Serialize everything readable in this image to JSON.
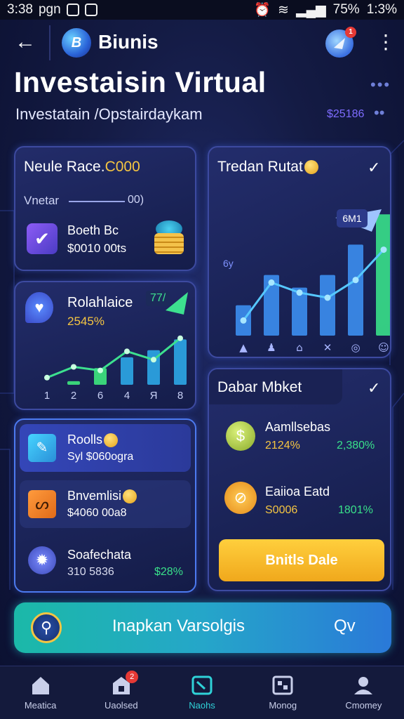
{
  "status_bar": {
    "time_left": "3:38",
    "carrier": "pgn",
    "battery": "75%",
    "time_right": "1:3%"
  },
  "header": {
    "app_name": "Biunis",
    "logo_text": "B",
    "notif_count": "1"
  },
  "title": "Investaisin Virtual",
  "subtitle": "Investatain /Opstairdaykam",
  "subtitle_amount": "$25186",
  "card_rate": {
    "title": "Neule Race.",
    "title_value": "C000",
    "row_label": "Vnetar",
    "row_value": "00)",
    "item_name": "Boeth Bc",
    "item_value": "$0010 00ts"
  },
  "card_trend": {
    "title": "Tredan Rutat",
    "badge": "6M1",
    "ylabel": "6y",
    "values": [
      1.2,
      2.4,
      1.9,
      2.4,
      3.6,
      4.8
    ],
    "line": [
      0.6,
      2.1,
      1.7,
      1.5,
      2.2,
      3.4
    ]
  },
  "card_perf": {
    "title": "Rolahlaice",
    "value": "2545%",
    "tag": "77/",
    "xlabels": [
      "1",
      "2",
      "6",
      "4",
      "Я",
      "8"
    ],
    "bars": [
      0,
      0.3,
      1.4,
      2.3,
      2.9,
      3.8
    ],
    "line": [
      0.6,
      1.5,
      1.2,
      2.8,
      2.1,
      3.9
    ]
  },
  "card_list": {
    "items": [
      {
        "name": "Roolls",
        "value": "Syl $060ogra",
        "icon": "ruler-icon"
      },
      {
        "name": "Bnvemlisi",
        "value": "$4060 00a8",
        "icon": "swirl-icon"
      },
      {
        "name": "Soafechata",
        "value": "310 5836",
        "change": "$28%",
        "icon": "gear-icon"
      }
    ]
  },
  "card_market": {
    "title": "Dabar Mbket",
    "items": [
      {
        "name": "Aamllsebas",
        "change_a": "2124%",
        "change_b": "2,380%"
      },
      {
        "name": "Eaiioa Eatd",
        "value": "S0006",
        "change_b": "1801%"
      }
    ],
    "button": "Bnitls Dale"
  },
  "cta": {
    "label": "Inapkan Varsolgis",
    "right": "Qv"
  },
  "nav": [
    {
      "label": "Meatica",
      "icon": "home-icon"
    },
    {
      "label": "Uaolsed",
      "icon": "store-icon",
      "badge": "2"
    },
    {
      "label": "Naohs",
      "icon": "chart-icon"
    },
    {
      "label": "Monog",
      "icon": "calendar-icon"
    },
    {
      "label": "Cmomey",
      "icon": "user-icon"
    }
  ],
  "colors": {
    "accent": "#2fd2d8",
    "green": "#39e08a",
    "gold": "#f5c542",
    "bg": "#141b44"
  }
}
